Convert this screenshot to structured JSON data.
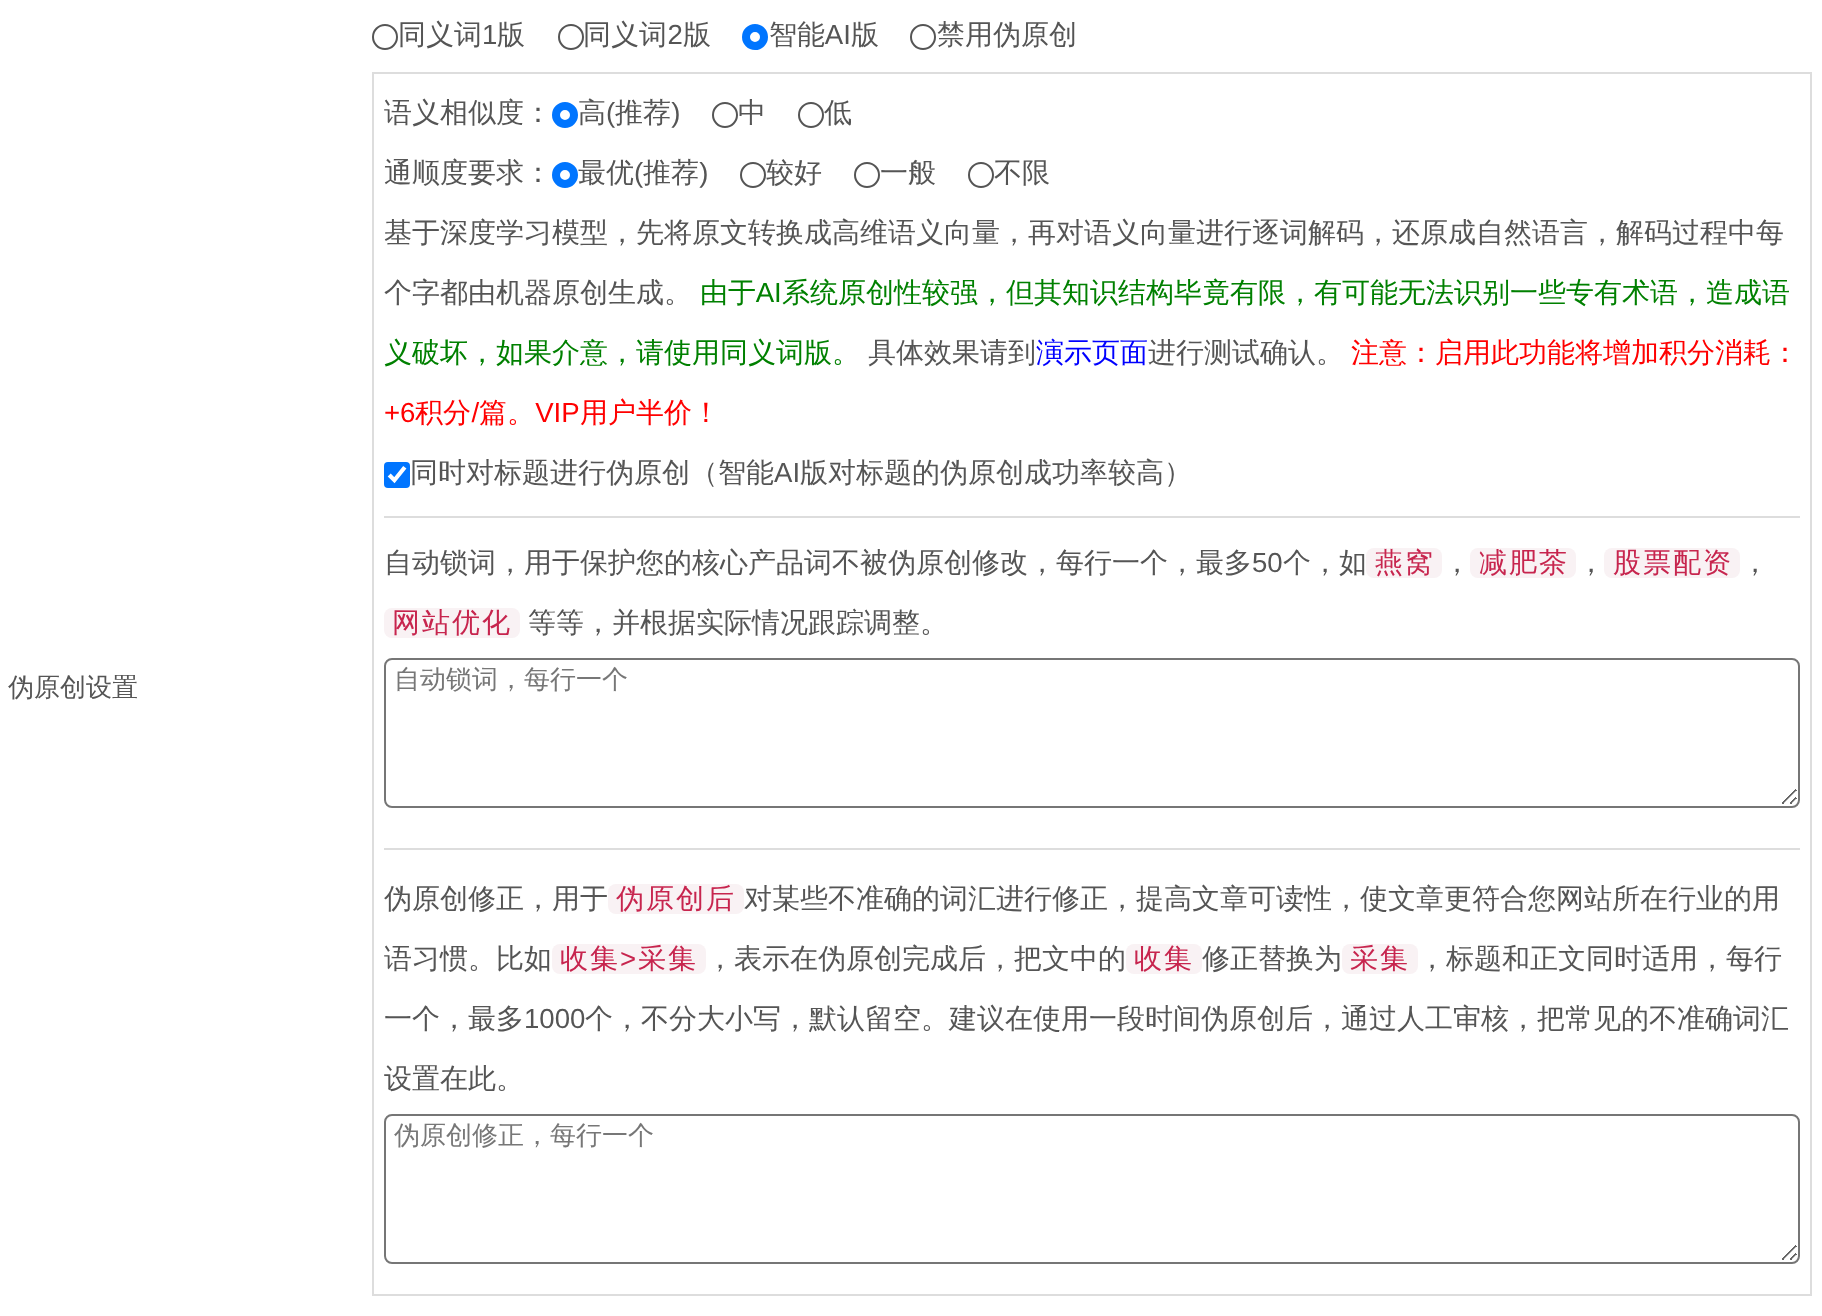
{
  "side_label": "伪原创设置",
  "mode_options": [
    {
      "label": "同义词1版",
      "selected": false
    },
    {
      "label": "同义词2版",
      "selected": false
    },
    {
      "label": "智能AI版",
      "selected": true
    },
    {
      "label": "禁用伪原创",
      "selected": false
    }
  ],
  "similarity": {
    "label": "语义相似度：",
    "options": [
      {
        "label": "高(推荐)",
        "selected": true
      },
      {
        "label": "中",
        "selected": false
      },
      {
        "label": "低",
        "selected": false
      }
    ]
  },
  "fluency": {
    "label": "通顺度要求：",
    "options": [
      {
        "label": "最优(推荐)",
        "selected": true
      },
      {
        "label": "较好",
        "selected": false
      },
      {
        "label": "一般",
        "selected": false
      },
      {
        "label": "不限",
        "selected": false
      }
    ]
  },
  "ai_description": [
    {
      "kind": "text",
      "text": "基于深度学习模型，先将原文转换成高维语义向量，再对语义向量进行逐词解码，还原成自然语言，解码过程中每个字都由机器原创生成。 "
    },
    {
      "kind": "note",
      "text": "由于AI系统原创性较强，但其知识结构毕竟有限，有可能无法识别一些专有术语，造成语义破坏，如果介意，请使用同义词版。"
    },
    {
      "kind": "text",
      "text": " 具体效果请到"
    },
    {
      "kind": "link",
      "text": "演示页面"
    },
    {
      "kind": "text",
      "text": "进行测试确认。 "
    },
    {
      "kind": "warning",
      "text": "注意：启用此功能将增加积分消耗：+6积分/篇。VIP用户半价！"
    }
  ],
  "title_checkbox": {
    "label": "同时对标题进行伪原创（智能AI版对标题的伪原创成功率较高）",
    "checked": true
  },
  "lock_words": {
    "description": [
      {
        "kind": "text",
        "text": "自动锁词，用于保护您的核心产品词不被伪原创修改，每行一个，最多50个，如"
      },
      {
        "kind": "code",
        "text": "燕窝"
      },
      {
        "kind": "text",
        "text": "，"
      },
      {
        "kind": "code",
        "text": "减肥茶"
      },
      {
        "kind": "text",
        "text": "，"
      },
      {
        "kind": "code",
        "text": "股票配资"
      },
      {
        "kind": "text",
        "text": "，"
      },
      {
        "kind": "code",
        "text": "网站优化"
      },
      {
        "kind": "text",
        "text": " 等等，并根据实际情况跟踪调整。"
      }
    ],
    "placeholder": "自动锁词，每行一个"
  },
  "corrections": {
    "description": [
      {
        "kind": "text",
        "text": "伪原创修正，用于"
      },
      {
        "kind": "code",
        "text": "伪原创后"
      },
      {
        "kind": "text",
        "text": "对某些不准确的词汇进行修正，提高文章可读性，使文章更符合您网站所在行业的用语习惯。比如"
      },
      {
        "kind": "code",
        "text": "收集>采集"
      },
      {
        "kind": "text",
        "text": "，表示在伪原创完成后，把文中的"
      },
      {
        "kind": "code",
        "text": "收集"
      },
      {
        "kind": "text",
        "text": "修正替换为"
      },
      {
        "kind": "code",
        "text": "采集"
      },
      {
        "kind": "text",
        "text": "，标题和正文同时适用，每行一个，最多1000个，不分大小写，默认留空。建议在使用一段时间伪原创后，通过人工审核，把常见的不准确词汇设置在此。"
      }
    ],
    "placeholder": "伪原创修正，每行一个"
  }
}
